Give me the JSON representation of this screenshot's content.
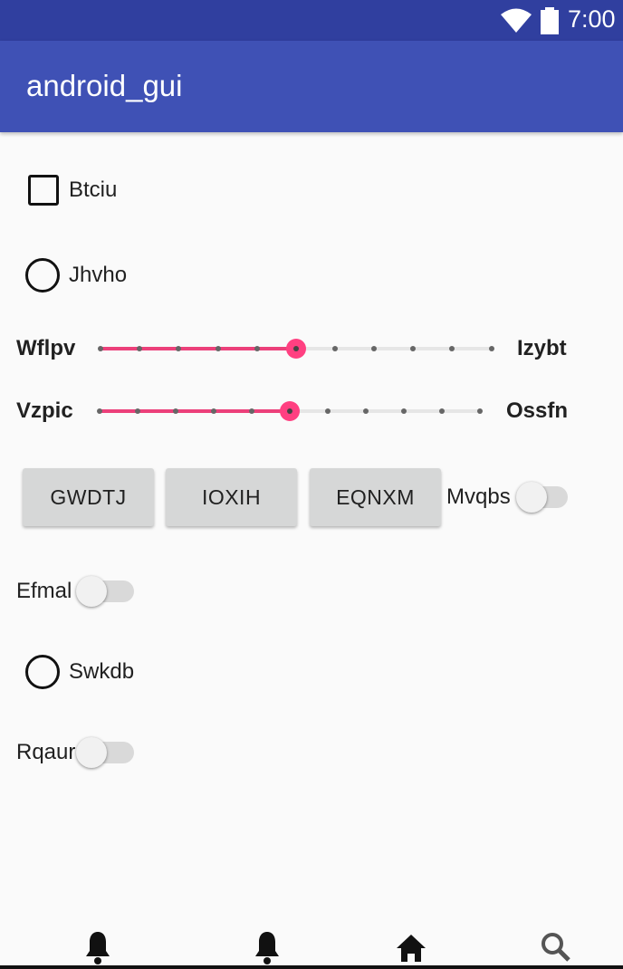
{
  "status_bar": {
    "time": "7:00"
  },
  "app_bar": {
    "title": "android_gui"
  },
  "checkbox": {
    "label": "Btciu",
    "checked": false
  },
  "radio_1": {
    "label": "Jhvho",
    "selected": false
  },
  "seekbar_1": {
    "left_label": "Wflpv",
    "right_label": "Izybt",
    "steps": 10,
    "value": 5
  },
  "seekbar_2": {
    "left_label": "Vzpic",
    "right_label": "Ossfn",
    "steps": 10,
    "value": 5
  },
  "buttons": {
    "b1": "GWDTJ",
    "b2": "IOXIH",
    "b3": "EQNXM"
  },
  "switch_1": {
    "label": "Mvqbs",
    "on": false
  },
  "switch_2": {
    "label": "Efmal",
    "on": false
  },
  "radio_2": {
    "label": "Swkdb",
    "selected": false
  },
  "switch_3": {
    "label": "Rqaur",
    "on": false
  },
  "bottom_nav": [
    "bell-icon",
    "bell-icon",
    "home-icon",
    "search-icon"
  ],
  "colors": {
    "status_bar": "#303f9f",
    "app_bar": "#3f51b5",
    "accent": "#ff4081",
    "background": "#fafafa"
  }
}
